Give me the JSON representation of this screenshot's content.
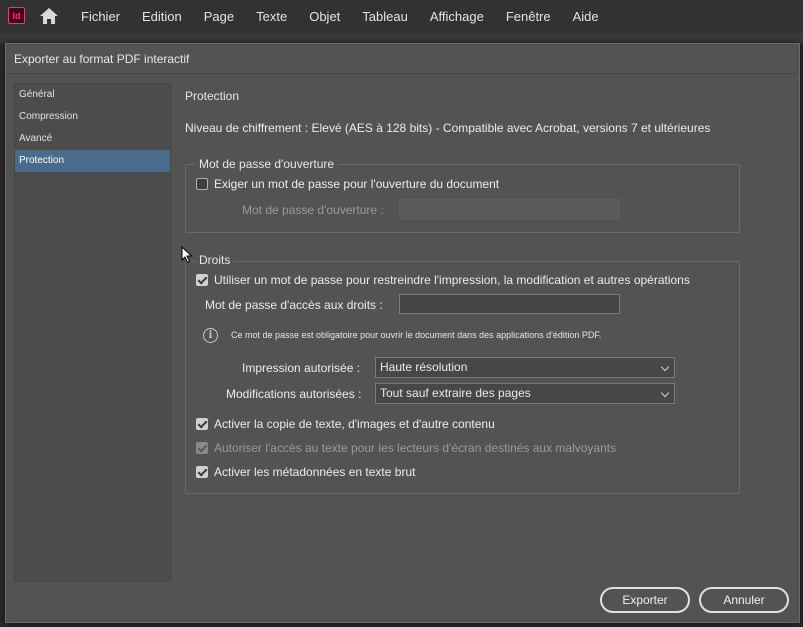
{
  "app": {
    "logo_text": "Id",
    "menu": [
      "Fichier",
      "Edition",
      "Page",
      "Texte",
      "Objet",
      "Tableau",
      "Affichage",
      "Fenêtre",
      "Aide"
    ]
  },
  "dialog": {
    "title": "Exporter au format PDF interactif",
    "sidebar": {
      "items": [
        {
          "label": "Général"
        },
        {
          "label": "Compression"
        },
        {
          "label": "Avancé"
        },
        {
          "label": "Protection"
        }
      ],
      "active_index": 3
    },
    "section_heading": "Protection",
    "encryption_level": "Niveau de chiffrement : Elevé (AES à 128 bits) - Compatible avec Acrobat, versions 7 et ultérieures",
    "open_password_group": {
      "legend": "Mot de passe d'ouverture",
      "require_checkbox_label": "Exiger un mot de passe pour l'ouverture du document",
      "require_checked": false,
      "password_label": "Mot de passe d'ouverture :",
      "password_value": ""
    },
    "rights_group": {
      "legend": "Droits",
      "restrict_checkbox_label": "Utiliser un mot de passe pour restreindre l'impression, la modification et autres opérations",
      "restrict_checked": true,
      "rights_password_label": "Mot de passe d'accès aux droits :",
      "rights_password_value": "",
      "info_text": "Ce mot de passe est obligatoire pour ouvrir le document dans des applications d'édition PDF.",
      "printing_label": "Impression autorisée :",
      "printing_value": "Haute résolution",
      "changes_label": "Modifications autorisées :",
      "changes_value": "Tout sauf extraire des pages",
      "copy_label": "Activer la copie de texte, d'images et d'autre contenu",
      "copy_checked": true,
      "screen_reader_label": "Autoriser l'accès au texte pour les lecteurs d'écran destinés aux malvoyants",
      "screen_reader_checked": true,
      "metadata_label": "Activer les métadonnées en texte brut",
      "metadata_checked": true
    },
    "buttons": {
      "export": "Exporter",
      "cancel": "Annuler"
    }
  },
  "colors": {
    "dialog_bg": "#535353",
    "active_item": "#4a6b8c",
    "menubar_bg": "#323232",
    "logo_accent": "#ff3366"
  }
}
